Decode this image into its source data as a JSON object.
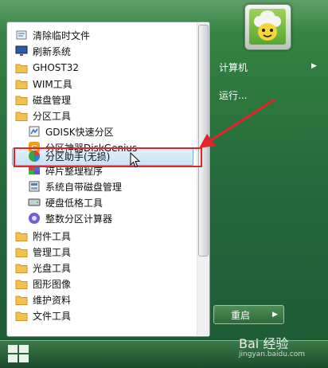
{
  "left_menu": {
    "items": [
      {
        "label": "清除临时文件",
        "icon": "broom-icon"
      },
      {
        "label": "刷新系统",
        "icon": "monitor-icon"
      },
      {
        "label": "GHOST32",
        "icon": "folder-icon"
      },
      {
        "label": "WIM工具",
        "icon": "folder-icon"
      },
      {
        "label": "磁盘管理",
        "icon": "folder-icon"
      },
      {
        "label": "分区工具",
        "icon": "folder-icon"
      },
      {
        "label": "GDISK快速分区",
        "icon": "gdisk-icon"
      },
      {
        "label": "分区神器DiskGenius",
        "icon": "diskgenius-icon"
      },
      {
        "label": "分区助手(无损)",
        "icon": "partition-assistant-icon"
      },
      {
        "label": "碎片整理程序",
        "icon": "defrag-icon"
      },
      {
        "label": "系统自带磁盘管理",
        "icon": "disk-management-icon"
      },
      {
        "label": "硬盘低格工具",
        "icon": "hdd-icon"
      },
      {
        "label": "整数分区计算器",
        "icon": "calculator-icon"
      },
      {
        "label": "附件工具",
        "icon": "folder-icon"
      },
      {
        "label": "管理工具",
        "icon": "folder-icon"
      },
      {
        "label": "光盘工具",
        "icon": "folder-icon"
      },
      {
        "label": "图形图像",
        "icon": "folder-icon"
      },
      {
        "label": "维护资料",
        "icon": "folder-icon"
      },
      {
        "label": "文件工具",
        "icon": "folder-icon"
      }
    ]
  },
  "right_pane": {
    "computer_label": "计算机",
    "run_label": "运行..."
  },
  "shutdown": {
    "label": "重启"
  },
  "watermark": {
    "brand": "Bai 经验",
    "url": "jingyan.baidu.com"
  },
  "colors": {
    "accent_red": "#e3242b",
    "highlight_border": "#7cb0dd",
    "background_green": "#2e7a3f"
  }
}
